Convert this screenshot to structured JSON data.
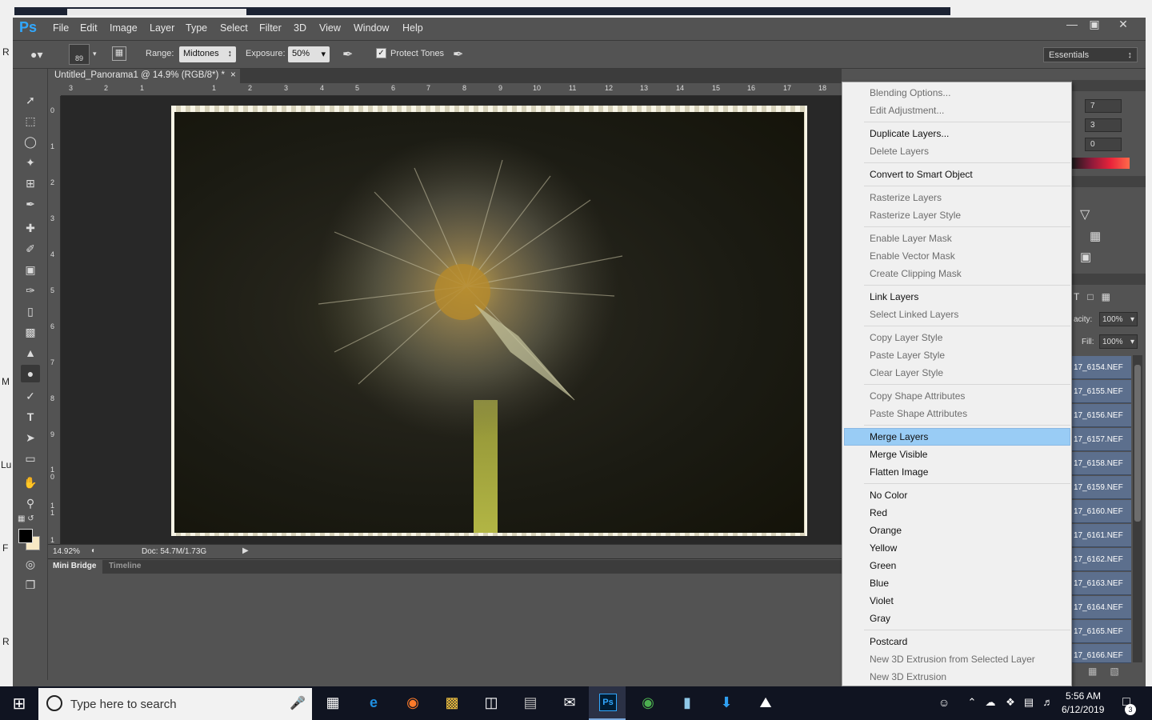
{
  "window": {
    "app": "Ps"
  },
  "menubar": [
    "File",
    "Edit",
    "Image",
    "Layer",
    "Type",
    "Select",
    "Filter",
    "3D",
    "View",
    "Window",
    "Help"
  ],
  "options": {
    "brush_size": "89",
    "range_label": "Range:",
    "range_value": "Midtones",
    "exposure_label": "Exposure:",
    "exposure_value": "50%",
    "protect_tones": "Protect Tones",
    "workspace": "Essentials"
  },
  "document": {
    "tab_title": "Untitled_Panorama1 @ 14.9% (RGB/8*) *",
    "zoom": "14.92%",
    "doc_size": "Doc: 54.7M/1.73G",
    "ruler_top": [
      "3",
      "2",
      "1",
      "1",
      "2",
      "3",
      "4",
      "5",
      "6",
      "7",
      "8",
      "9",
      "10",
      "11",
      "12",
      "13",
      "14",
      "15",
      "16",
      "17",
      "18"
    ],
    "ruler_left": [
      "0",
      "1",
      "2",
      "3",
      "4",
      "5",
      "6",
      "7",
      "8",
      "9",
      "1 0",
      "1 1",
      "1"
    ]
  },
  "bottom_panel": {
    "tabs": [
      "Mini Bridge",
      "Timeline"
    ]
  },
  "right_panel": {
    "color_values": [
      "7",
      "3",
      "0"
    ],
    "opacity_label": "acity:",
    "opacity_value": "100%",
    "fill_label": "Fill:",
    "fill_value": "100%",
    "layers": [
      "17_6154.NEF",
      "17_6155.NEF",
      "17_6156.NEF",
      "17_6157.NEF",
      "17_6158.NEF",
      "17_6159.NEF",
      "17_6160.NEF",
      "17_6161.NEF",
      "17_6162.NEF",
      "17_6163.NEF",
      "17_6164.NEF",
      "17_6165.NEF",
      "17_6166.NEF"
    ]
  },
  "context_menu": {
    "highlighted": "Merge Layers",
    "groups": [
      [
        {
          "label": "Blending Options...",
          "enabled": false
        },
        {
          "label": "Edit Adjustment...",
          "enabled": false
        }
      ],
      [
        {
          "label": "Duplicate Layers...",
          "enabled": true
        },
        {
          "label": "Delete Layers",
          "enabled": false
        }
      ],
      [
        {
          "label": "Convert to Smart Object",
          "enabled": true
        }
      ],
      [
        {
          "label": "Rasterize Layers",
          "enabled": false
        },
        {
          "label": "Rasterize Layer Style",
          "enabled": false
        }
      ],
      [
        {
          "label": "Enable Layer Mask",
          "enabled": false
        },
        {
          "label": "Enable Vector Mask",
          "enabled": false
        },
        {
          "label": "Create Clipping Mask",
          "enabled": false
        }
      ],
      [
        {
          "label": "Link Layers",
          "enabled": true
        },
        {
          "label": "Select Linked Layers",
          "enabled": false
        }
      ],
      [
        {
          "label": "Copy Layer Style",
          "enabled": false
        },
        {
          "label": "Paste Layer Style",
          "enabled": false
        },
        {
          "label": "Clear Layer Style",
          "enabled": false
        }
      ],
      [
        {
          "label": "Copy Shape Attributes",
          "enabled": false
        },
        {
          "label": "Paste Shape Attributes",
          "enabled": false
        }
      ],
      [
        {
          "label": "Merge Layers",
          "enabled": true
        },
        {
          "label": "Merge Visible",
          "enabled": true
        },
        {
          "label": "Flatten Image",
          "enabled": true
        }
      ],
      [
        {
          "label": "No Color",
          "enabled": true
        },
        {
          "label": "Red",
          "enabled": true
        },
        {
          "label": "Orange",
          "enabled": true
        },
        {
          "label": "Yellow",
          "enabled": true
        },
        {
          "label": "Green",
          "enabled": true
        },
        {
          "label": "Blue",
          "enabled": true
        },
        {
          "label": "Violet",
          "enabled": true
        },
        {
          "label": "Gray",
          "enabled": true
        }
      ],
      [
        {
          "label": "Postcard",
          "enabled": true
        },
        {
          "label": "New 3D Extrusion from Selected Layer",
          "enabled": false
        },
        {
          "label": "New 3D Extrusion",
          "enabled": false
        }
      ]
    ]
  },
  "taskbar": {
    "search_placeholder": "Type here to search",
    "time": "5:56 AM",
    "date": "6/12/2019",
    "notification_count": "3",
    "apps": [
      "start-icon",
      "task-view-icon",
      "edge-icon",
      "firefox-icon",
      "file-explorer-icon",
      "store-icon",
      "app-icon",
      "mail-icon",
      "photoshop-icon",
      "chrome-icon",
      "notes-icon",
      "download-icon",
      "photos-icon"
    ]
  },
  "desktop_letters": [
    "R",
    "Lu",
    "M",
    "F",
    "R"
  ],
  "colors": {
    "ps_bg": "#535353",
    "menu_highlight": "#99ccf5",
    "layer_selected": "#5c6f8d",
    "taskbar": "#101421"
  }
}
